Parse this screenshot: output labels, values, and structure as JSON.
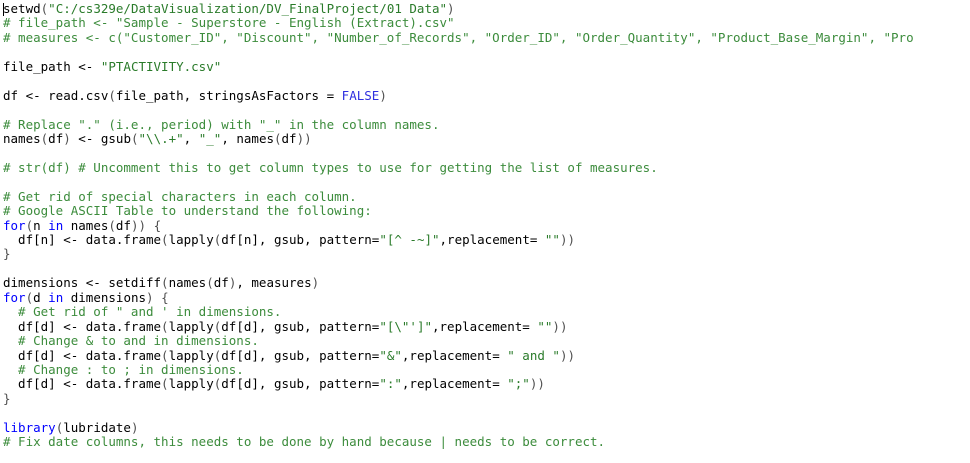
{
  "editor": {
    "colors": {
      "background": "#ffffff",
      "comment": "#3c8c3c",
      "string": "#2a7b2a",
      "keyword": "#0000ff",
      "constant": "#3030e0",
      "plain": "#000000",
      "paren": "#505050"
    },
    "lines": [
      [
        {
          "t": "plain",
          "v": "setwd"
        },
        {
          "t": "paren",
          "v": "("
        },
        {
          "t": "string",
          "v": "\"C:/cs329e/DataVisualization/DV_FinalProject/01 Data\""
        },
        {
          "t": "paren",
          "v": ")"
        }
      ],
      [
        {
          "t": "comment",
          "v": "# file_path <- \"Sample - Superstore - English (Extract).csv\""
        }
      ],
      [
        {
          "t": "comment",
          "v": "# measures <- c(\"Customer_ID\", \"Discount\", \"Number_of_Records\", \"Order_ID\", \"Order_Quantity\", \"Product_Base_Margin\", \"Pro"
        }
      ],
      [],
      [
        {
          "t": "plain",
          "v": "file_path <- "
        },
        {
          "t": "string",
          "v": "\"PTACTIVITY.csv\""
        }
      ],
      [],
      [
        {
          "t": "plain",
          "v": "df <- read.csv"
        },
        {
          "t": "paren",
          "v": "("
        },
        {
          "t": "plain",
          "v": "file_path, stringsAsFactors = "
        },
        {
          "t": "const",
          "v": "FALSE"
        },
        {
          "t": "paren",
          "v": ")"
        }
      ],
      [],
      [
        {
          "t": "comment",
          "v": "# Replace \".\" (i.e., period) with \"_\" in the column names."
        }
      ],
      [
        {
          "t": "plain",
          "v": "names"
        },
        {
          "t": "paren",
          "v": "("
        },
        {
          "t": "plain",
          "v": "df"
        },
        {
          "t": "paren",
          "v": ")"
        },
        {
          "t": "plain",
          "v": " <- gsub"
        },
        {
          "t": "paren",
          "v": "("
        },
        {
          "t": "string",
          "v": "\"\\\\.+\""
        },
        {
          "t": "plain",
          "v": ", "
        },
        {
          "t": "string",
          "v": "\"_\""
        },
        {
          "t": "plain",
          "v": ", names"
        },
        {
          "t": "paren",
          "v": "("
        },
        {
          "t": "plain",
          "v": "df"
        },
        {
          "t": "paren",
          "v": "))"
        }
      ],
      [],
      [
        {
          "t": "comment",
          "v": "# str(df) # Uncomment this to get column types to use for getting the list of measures."
        }
      ],
      [],
      [
        {
          "t": "comment",
          "v": "# Get rid of special characters in each column."
        }
      ],
      [
        {
          "t": "comment",
          "v": "# Google ASCII Table to understand the following:"
        }
      ],
      [
        {
          "t": "keyword",
          "v": "for"
        },
        {
          "t": "paren",
          "v": "("
        },
        {
          "t": "plain",
          "v": "n "
        },
        {
          "t": "keyword",
          "v": "in"
        },
        {
          "t": "plain",
          "v": " names"
        },
        {
          "t": "paren",
          "v": "("
        },
        {
          "t": "plain",
          "v": "df"
        },
        {
          "t": "paren",
          "v": "))"
        },
        {
          "t": "plain",
          "v": " "
        },
        {
          "t": "paren",
          "v": "{"
        }
      ],
      [
        {
          "t": "plain",
          "v": "  df[n] <- data.frame"
        },
        {
          "t": "paren",
          "v": "("
        },
        {
          "t": "plain",
          "v": "lapply"
        },
        {
          "t": "paren",
          "v": "("
        },
        {
          "t": "plain",
          "v": "df[n], gsub, pattern="
        },
        {
          "t": "string",
          "v": "\"[^ -~]\""
        },
        {
          "t": "plain",
          "v": ",replacement= "
        },
        {
          "t": "string",
          "v": "\"\""
        },
        {
          "t": "paren",
          "v": "))"
        }
      ],
      [
        {
          "t": "paren",
          "v": "}"
        }
      ],
      [],
      [
        {
          "t": "plain",
          "v": "dimensions <- setdiff"
        },
        {
          "t": "paren",
          "v": "("
        },
        {
          "t": "plain",
          "v": "names"
        },
        {
          "t": "paren",
          "v": "("
        },
        {
          "t": "plain",
          "v": "df"
        },
        {
          "t": "paren",
          "v": ")"
        },
        {
          "t": "plain",
          "v": ", measures"
        },
        {
          "t": "paren",
          "v": ")"
        }
      ],
      [
        {
          "t": "keyword",
          "v": "for"
        },
        {
          "t": "paren",
          "v": "("
        },
        {
          "t": "plain",
          "v": "d "
        },
        {
          "t": "keyword",
          "v": "in"
        },
        {
          "t": "plain",
          "v": " dimensions"
        },
        {
          "t": "paren",
          "v": ")"
        },
        {
          "t": "plain",
          "v": " "
        },
        {
          "t": "paren",
          "v": "{"
        }
      ],
      [
        {
          "t": "comment",
          "v": "  # Get rid of \" and ' in dimensions."
        }
      ],
      [
        {
          "t": "plain",
          "v": "  df[d] <- data.frame"
        },
        {
          "t": "paren",
          "v": "("
        },
        {
          "t": "plain",
          "v": "lapply"
        },
        {
          "t": "paren",
          "v": "("
        },
        {
          "t": "plain",
          "v": "df[d], gsub, pattern="
        },
        {
          "t": "string",
          "v": "\"[\\\"']\""
        },
        {
          "t": "plain",
          "v": ",replacement= "
        },
        {
          "t": "string",
          "v": "\"\""
        },
        {
          "t": "paren",
          "v": "))"
        }
      ],
      [
        {
          "t": "comment",
          "v": "  # Change & to and in dimensions."
        }
      ],
      [
        {
          "t": "plain",
          "v": "  df[d] <- data.frame"
        },
        {
          "t": "paren",
          "v": "("
        },
        {
          "t": "plain",
          "v": "lapply"
        },
        {
          "t": "paren",
          "v": "("
        },
        {
          "t": "plain",
          "v": "df[d], gsub, pattern="
        },
        {
          "t": "string",
          "v": "\"&\""
        },
        {
          "t": "plain",
          "v": ",replacement= "
        },
        {
          "t": "string",
          "v": "\" and \""
        },
        {
          "t": "paren",
          "v": "))"
        }
      ],
      [
        {
          "t": "comment",
          "v": "  # Change : to ; in dimensions."
        }
      ],
      [
        {
          "t": "plain",
          "v": "  df[d] <- data.frame"
        },
        {
          "t": "paren",
          "v": "("
        },
        {
          "t": "plain",
          "v": "lapply"
        },
        {
          "t": "paren",
          "v": "("
        },
        {
          "t": "plain",
          "v": "df[d], gsub, pattern="
        },
        {
          "t": "string",
          "v": "\":\""
        },
        {
          "t": "plain",
          "v": ",replacement= "
        },
        {
          "t": "string",
          "v": "\";\""
        },
        {
          "t": "paren",
          "v": "))"
        }
      ],
      [
        {
          "t": "paren",
          "v": "}"
        }
      ],
      [],
      [
        {
          "t": "keyword",
          "v": "library"
        },
        {
          "t": "paren",
          "v": "("
        },
        {
          "t": "plain",
          "v": "lubridate"
        },
        {
          "t": "paren",
          "v": ")"
        }
      ],
      [
        {
          "t": "comment",
          "v": "# Fix date columns, this needs to be done by hand because | needs to be correct."
        }
      ]
    ]
  }
}
